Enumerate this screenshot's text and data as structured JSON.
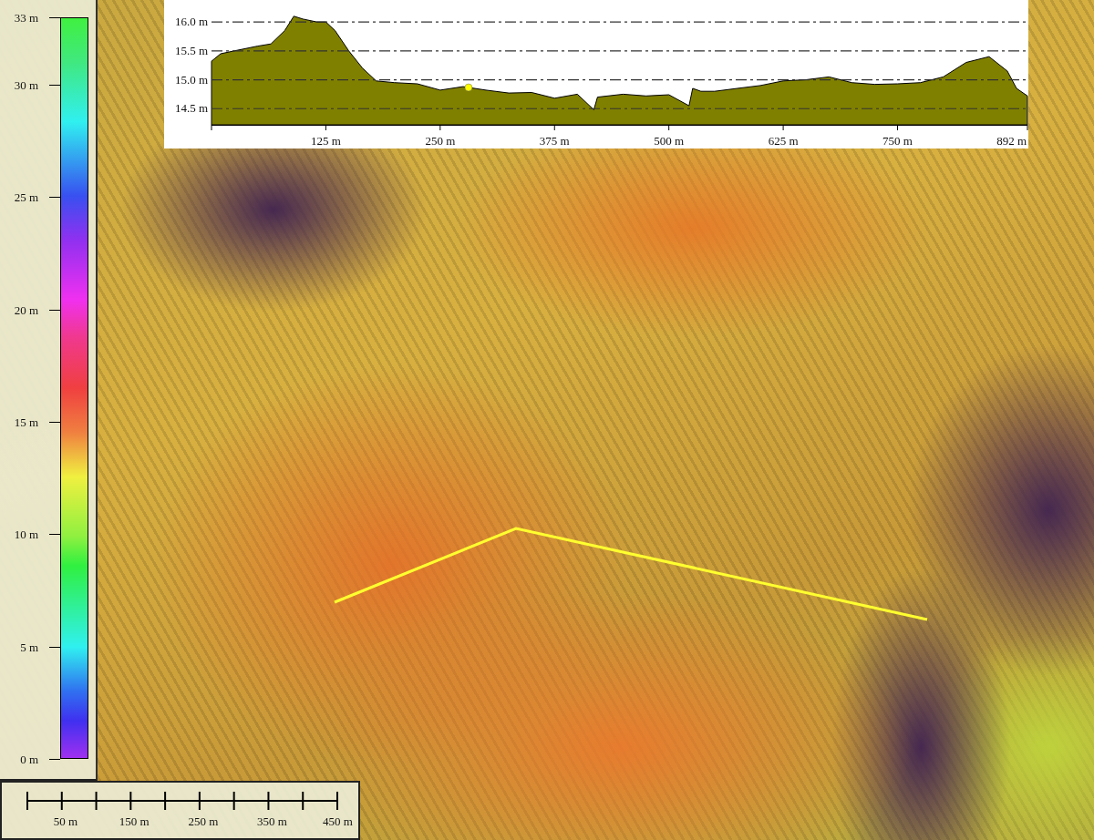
{
  "legend": {
    "labels": [
      "33 m",
      "30 m",
      "25 m",
      "20 m",
      "15 m",
      "10 m",
      "5 m",
      "0 m"
    ]
  },
  "profile": {
    "chart_data": {
      "type": "area",
      "x": [
        0,
        10,
        25,
        50,
        65,
        80,
        90,
        100,
        115,
        125,
        135,
        150,
        165,
        180,
        200,
        225,
        250,
        275,
        300,
        325,
        350,
        375,
        400,
        418,
        422,
        450,
        475,
        500,
        522,
        526,
        535,
        550,
        575,
        600,
        625,
        650,
        675,
        700,
        725,
        750,
        775,
        800,
        825,
        850,
        870,
        880,
        892
      ],
      "series": [
        {
          "color": "#808000",
          "values": [
            15.32,
            15.45,
            15.5,
            15.58,
            15.62,
            15.85,
            16.1,
            16.05,
            16.0,
            16.0,
            15.85,
            15.5,
            15.2,
            14.98,
            14.95,
            14.93,
            14.82,
            14.88,
            14.82,
            14.77,
            14.78,
            14.68,
            14.75,
            14.48,
            14.7,
            14.75,
            14.72,
            14.74,
            14.55,
            14.85,
            14.8,
            14.8,
            14.85,
            14.9,
            14.98,
            15.0,
            15.05,
            14.95,
            14.92,
            14.93,
            14.95,
            15.05,
            15.3,
            15.4,
            15.15,
            14.85,
            14.72
          ]
        }
      ],
      "xlim": [
        0,
        892
      ],
      "ylim": [
        14.22,
        16.38
      ],
      "xticks": [
        {
          "value": 125,
          "label": "125 m"
        },
        {
          "value": 250,
          "label": "250 m"
        },
        {
          "value": 375,
          "label": "375 m"
        },
        {
          "value": 500,
          "label": "500 m"
        },
        {
          "value": 625,
          "label": "625 m"
        },
        {
          "value": 750,
          "label": "750 m"
        },
        {
          "value": 892,
          "label": "892 m"
        }
      ],
      "yticks": [
        {
          "value": 14.5,
          "label": "14.5 m"
        },
        {
          "value": 15.0,
          "label": "15.0 m"
        },
        {
          "value": 15.5,
          "label": "15.5 m"
        },
        {
          "value": 16.0,
          "label": "16.0 m"
        }
      ],
      "grid": true
    },
    "cursor": {
      "level": 0.315
    }
  },
  "scale_bar": {
    "labels": [
      "50 m",
      "150 m",
      "250 m",
      "350 m",
      "450 m"
    ]
  }
}
